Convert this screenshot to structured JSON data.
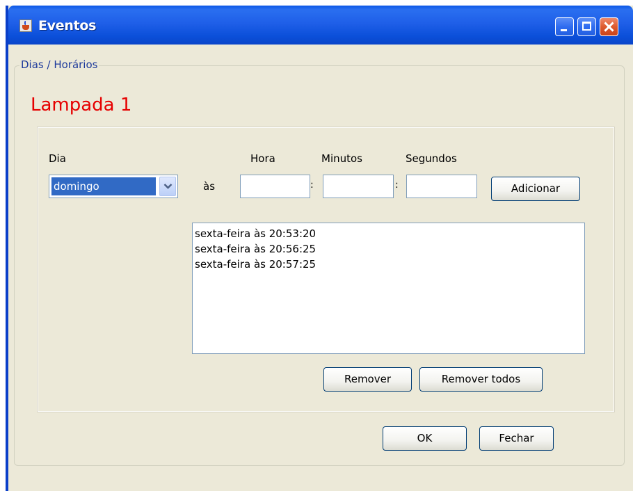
{
  "window": {
    "title": "Eventos"
  },
  "group": {
    "label": "Dias / Horários"
  },
  "lamp": {
    "title": "Lampada 1"
  },
  "form": {
    "dia_label": "Dia",
    "hora_label": "Hora",
    "minutos_label": "Minutos",
    "segundos_label": "Segundos",
    "as_label": "às",
    "colon": ":",
    "dia_selected": "domingo",
    "hora_value": "",
    "minutos_value": "",
    "segundos_value": "",
    "adicionar_label": "Adicionar"
  },
  "events_list": {
    "items": [
      "sexta-feira às 20:53:20",
      "sexta-feira às 20:56:25",
      "sexta-feira às 20:57:25"
    ]
  },
  "list_actions": {
    "remover_label": "Remover",
    "remover_todos_label": "Remover todos"
  },
  "dialog_actions": {
    "ok_label": "OK",
    "fechar_label": "Fechar"
  },
  "colors": {
    "title_bar": "#0b4fd9",
    "lamp_title": "#e60000",
    "group_label": "#1d3a9b",
    "selection": "#316ac5"
  },
  "icons": {
    "app": "java-cup-icon",
    "combo": "chevron-down-icon"
  }
}
